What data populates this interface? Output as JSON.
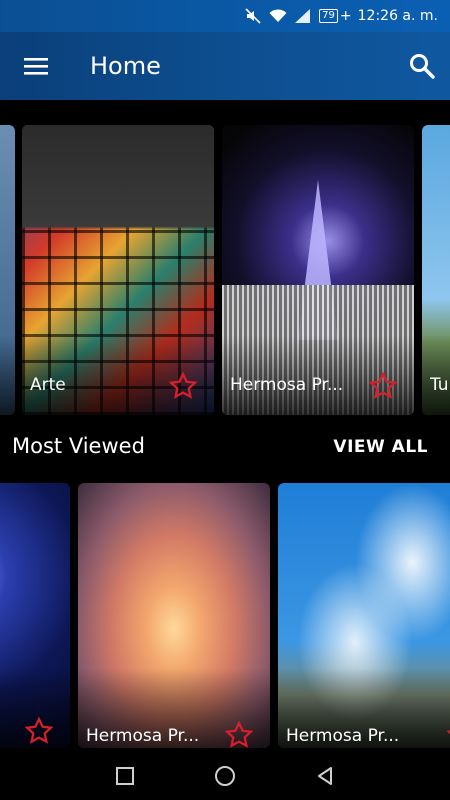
{
  "status_bar": {
    "battery": "79",
    "time": "12:26 a. m.",
    "icons": [
      "mute-icon",
      "wifi-icon",
      "signal-icon",
      "battery-icon"
    ]
  },
  "app_bar": {
    "title": "Home",
    "menu_icon": "menu-icon",
    "search_icon": "search-icon"
  },
  "featured": {
    "cards": [
      {
        "label": "",
        "image": "city-night-edge"
      },
      {
        "label": "Arte",
        "image": "stained-glass"
      },
      {
        "label": "Hermosa Pr...",
        "image": "temple-night-crowd"
      },
      {
        "label": "Tu",
        "image": "sky-day"
      }
    ]
  },
  "most_viewed": {
    "title": "Most Viewed",
    "view_all": "VIEW ALL",
    "cards": [
      {
        "label": "",
        "image": "night-city-spire"
      },
      {
        "label": "Hermosa Pr...",
        "image": "sunset-sky"
      },
      {
        "label": "Hermosa Pr...",
        "image": "blue-sky-people"
      }
    ]
  },
  "nav_bar": {
    "buttons": [
      "recent-apps-icon",
      "home-icon",
      "back-icon"
    ]
  },
  "colors": {
    "accent_star": "#d9202a",
    "appbar_blue": "#0d4e8f"
  }
}
